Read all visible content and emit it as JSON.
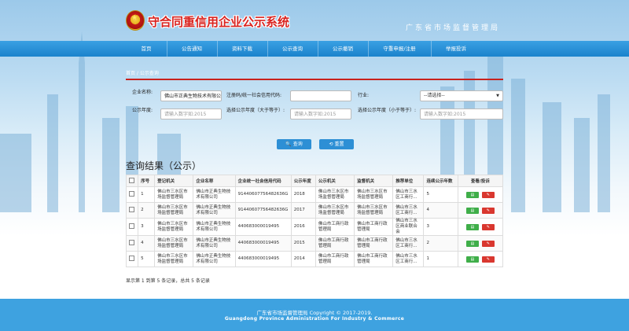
{
  "header": {
    "title": "守合同重信用企业公示系统",
    "subtitle": "广东省市场监督管理局"
  },
  "nav": {
    "items": [
      "首页",
      "公告通知",
      "资料下载",
      "公示查询",
      "公示撤销",
      "守重申报/注册",
      "举报投诉"
    ]
  },
  "breadcrumb": {
    "home": "首页",
    "sep": " / ",
    "current": "公示查询"
  },
  "form": {
    "company_label": "企业名称:",
    "company_value": "佛山市正典生物技术有限公司",
    "reg_label": "注册码/统一社会信用代码:",
    "reg_value": "",
    "industry_label": "行业:",
    "industry_selected": "--请选择--",
    "year_label": "公示年度:",
    "year_placeholder": "请输入数字如:2015",
    "year_ge_label": "选择公示年度（大于等于）:",
    "year_ge_placeholder": "请输入数字如:2015",
    "year_le_label": "选择公示年度（小于等于）:",
    "year_le_placeholder": "请输入数字如:2015",
    "search_button": "查询",
    "reset_button": "重置"
  },
  "results": {
    "title": "查询结果（公示）",
    "columns": [
      "序号",
      "登记机关",
      "企业名称",
      "企业统一社会信用代码",
      "公示年度",
      "公示机关",
      "监督机关",
      "推荐单位",
      "连续公示年数",
      "查看/投诉"
    ],
    "rows": [
      {
        "no": "1",
        "reg_org": "佛山市三水区市场监督管理局",
        "company": "佛山市正典生物技术有限公司",
        "code": "91440607756482636G",
        "year": "2018",
        "pub_org": "佛山市三水区市场监督管理局",
        "sup_org": "佛山市三水区市场监督管理局",
        "recommend": "佛山市三水区工商行...",
        "years": "5"
      },
      {
        "no": "2",
        "reg_org": "佛山市三水区市场监督管理局",
        "company": "佛山市正典生物技术有限公司",
        "code": "91440607756482636G",
        "year": "2017",
        "pub_org": "佛山市三水区市场监督管理局",
        "sup_org": "佛山市三水区市场监督管理局",
        "recommend": "佛山市三水区工商行...",
        "years": "4"
      },
      {
        "no": "3",
        "reg_org": "佛山市三水区市场监督管理局",
        "company": "佛山市正典生物技术有限公司",
        "code": "440683000019495",
        "year": "2016",
        "pub_org": "佛山市工商行政管理局",
        "sup_org": "佛山市工商行政管理局",
        "recommend": "佛山市三水区商业联合会",
        "years": "3"
      },
      {
        "no": "4",
        "reg_org": "佛山市三水区市场监督管理局",
        "company": "佛山市正典生物技术有限公司",
        "code": "440683000019495",
        "year": "2015",
        "pub_org": "佛山市工商行政管理局",
        "sup_org": "佛山市工商行政管理局",
        "recommend": "佛山市三水区工商行...",
        "years": "2"
      },
      {
        "no": "5",
        "reg_org": "佛山市三水区市场监督管理局",
        "company": "佛山市正典生物技术有限公司",
        "code": "440683000019495",
        "year": "2014",
        "pub_org": "佛山市工商行政管理局",
        "sup_org": "佛山市工商行政管理局",
        "recommend": "佛山市三水区工商行...",
        "years": "1"
      }
    ],
    "summary": "显示第 1 到第 5 条记录，总共 5 条记录"
  },
  "footer": {
    "line1": "广东省市场监督管理局 Copyright © 2017-2019.",
    "line2": "Guangdong Province Administration For Industry & Commerce"
  },
  "colors": {
    "nav": "#1b83cc",
    "title_red": "#d9231f",
    "footer": "#3ea2e0",
    "view_button": "#3fae49",
    "complain_button": "#d9372f"
  }
}
